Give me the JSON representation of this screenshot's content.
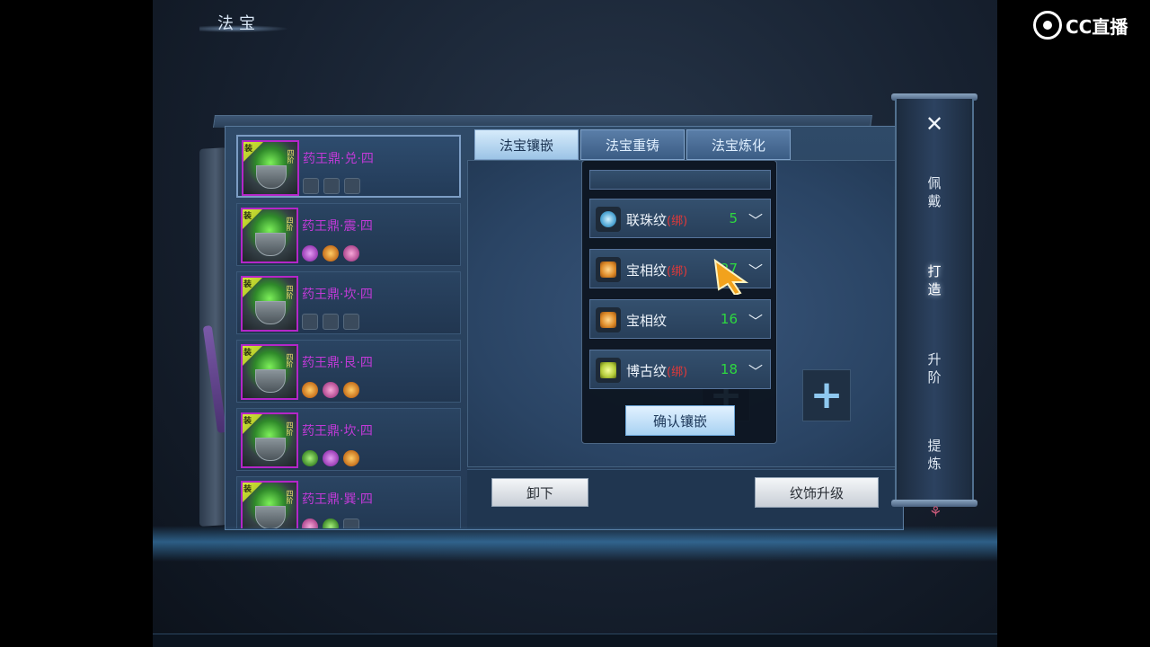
{
  "window": {
    "title": "法宝"
  },
  "tabs": [
    {
      "label": "法宝镶嵌",
      "active": true
    },
    {
      "label": "法宝重铸",
      "active": false
    },
    {
      "label": "法宝炼化",
      "active": false
    }
  ],
  "equip_list": [
    {
      "name": "药王鼎·兑·四",
      "flag": "装",
      "rank": "四阶",
      "selected": true,
      "gems": [
        "empty",
        "empty",
        "empty"
      ]
    },
    {
      "name": "药王鼎·震·四",
      "flag": "装",
      "rank": "四阶",
      "selected": false,
      "gems": [
        "purple",
        "orange",
        "pink"
      ]
    },
    {
      "name": "药王鼎·坎·四",
      "flag": "装",
      "rank": "四阶",
      "selected": false,
      "gems": [
        "empty",
        "empty",
        "empty"
      ]
    },
    {
      "name": "药王鼎·艮·四",
      "flag": "装",
      "rank": "四阶",
      "selected": false,
      "gems": [
        "orange",
        "pink",
        "orange"
      ]
    },
    {
      "name": "药王鼎·坎·四",
      "flag": "装",
      "rank": "四阶",
      "selected": false,
      "gems": [
        "green",
        "purple",
        "orange"
      ]
    },
    {
      "name": "药王鼎·巽·四",
      "flag": "装",
      "rank": "四阶",
      "selected": false,
      "gems": [
        "pink",
        "green",
        "empty"
      ]
    }
  ],
  "dropdown": {
    "items": [
      {
        "name": "联珠纹",
        "tag": "(绑)",
        "count": "5",
        "icon": "blue"
      },
      {
        "name": "宝相纹",
        "tag": "(绑)",
        "count": "27",
        "icon": "orange"
      },
      {
        "name": "宝相纹",
        "tag": "",
        "count": "16",
        "icon": "orange"
      },
      {
        "name": "博古纹",
        "tag": "(绑)",
        "count": "18",
        "icon": "green"
      }
    ],
    "confirm_label": "确认镶嵌"
  },
  "buttons": {
    "unequip": "卸下",
    "upgrade": "纹饰升级"
  },
  "side_nav": {
    "close": "✕",
    "items": [
      {
        "label": "佩戴",
        "active": false
      },
      {
        "label": "打造",
        "active": true
      },
      {
        "label": "升阶",
        "active": false
      },
      {
        "label": "提炼",
        "active": false
      }
    ]
  },
  "watermark": {
    "text": "CC直播"
  },
  "colors": {
    "equip_name": "#c23ad8",
    "bound_tag": "#e23838",
    "count": "#2ed840",
    "tab_active": "#d6ebfb"
  }
}
